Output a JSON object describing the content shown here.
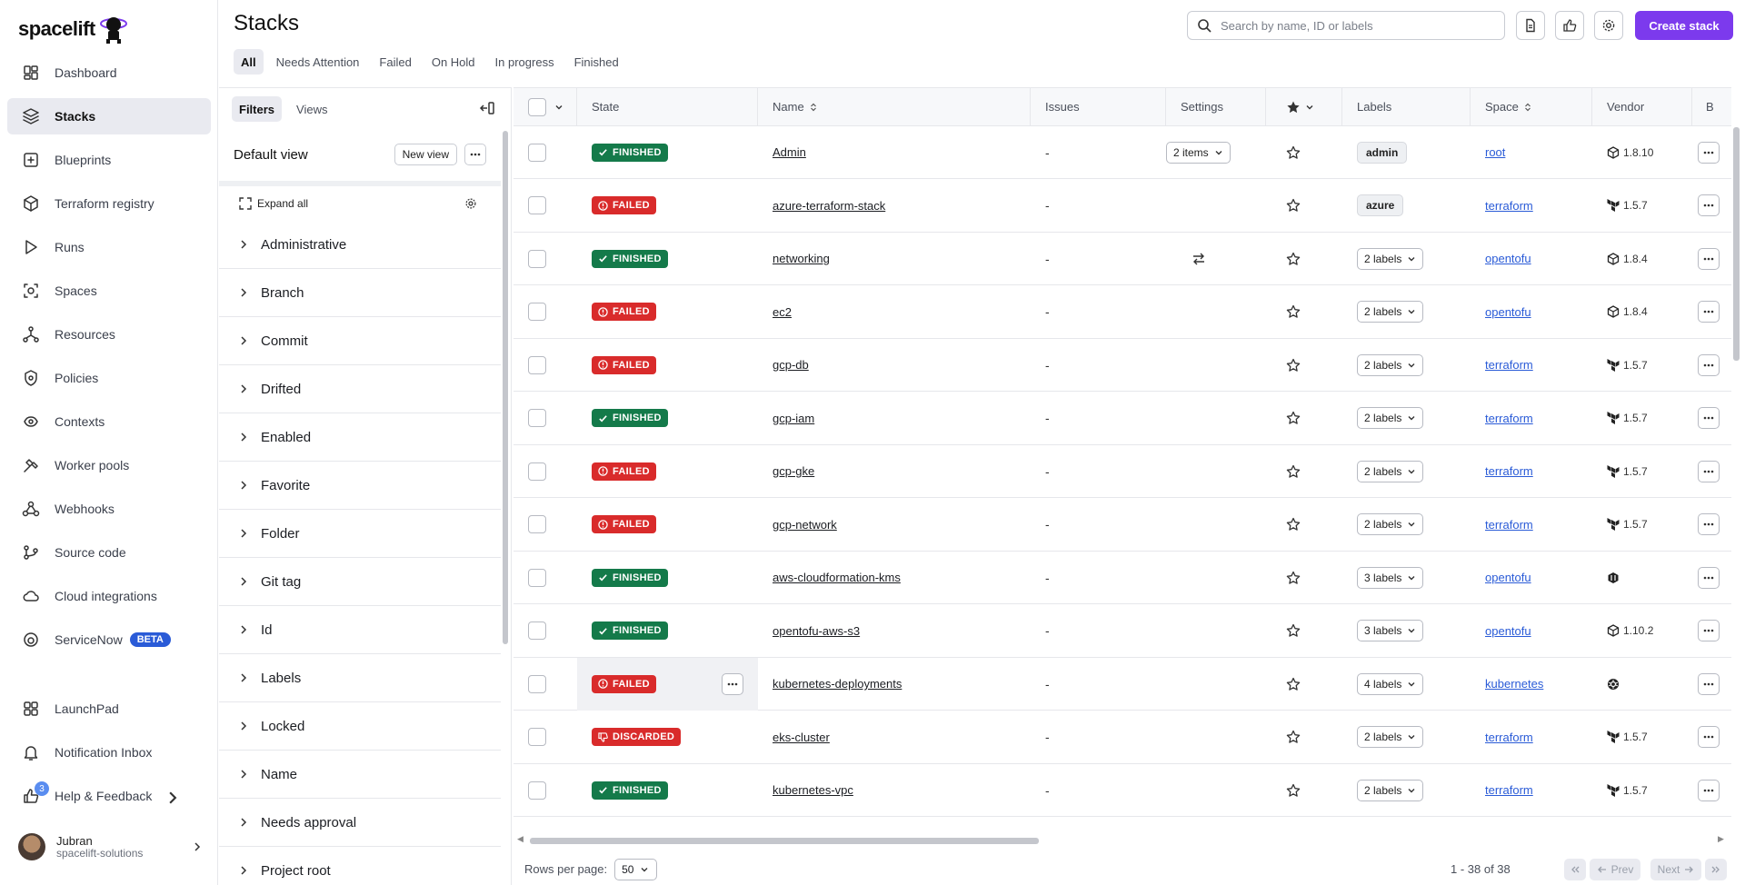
{
  "app": {
    "logo_text": "spacelift"
  },
  "sidebar": {
    "items": [
      {
        "label": "Dashboard",
        "icon": "dashboard-icon"
      },
      {
        "label": "Stacks",
        "icon": "stacks-icon",
        "active": true
      },
      {
        "label": "Blueprints",
        "icon": "blueprints-icon"
      },
      {
        "label": "Terraform registry",
        "icon": "cube-icon"
      },
      {
        "label": "Runs",
        "icon": "play-icon"
      },
      {
        "label": "Spaces",
        "icon": "spaces-icon"
      },
      {
        "label": "Resources",
        "icon": "resources-icon"
      },
      {
        "label": "Policies",
        "icon": "policies-icon"
      },
      {
        "label": "Contexts",
        "icon": "contexts-icon"
      },
      {
        "label": "Worker pools",
        "icon": "worker-pools-icon"
      },
      {
        "label": "Webhooks",
        "icon": "webhooks-icon"
      },
      {
        "label": "Source code",
        "icon": "source-code-icon"
      },
      {
        "label": "Cloud integrations",
        "icon": "cloud-icon"
      },
      {
        "label": "ServiceNow",
        "icon": "servicenow-icon",
        "badge": "BETA"
      }
    ],
    "bottom": [
      {
        "label": "LaunchPad",
        "icon": "launchpad-icon"
      },
      {
        "label": "Notification Inbox",
        "icon": "bell-icon"
      },
      {
        "label": "Help & Feedback",
        "icon": "thumbs-up-icon",
        "count": "3"
      }
    ],
    "user": {
      "name": "Jubran",
      "org": "spacelift-solutions"
    }
  },
  "header": {
    "title": "Stacks",
    "tabs": [
      "All",
      "Needs Attention",
      "Failed",
      "On Hold",
      "In progress",
      "Finished"
    ],
    "active_tab": "All",
    "search_placeholder": "Search by name, ID or labels",
    "create_label": "Create stack"
  },
  "filters": {
    "tabs": [
      "Filters",
      "Views"
    ],
    "view_title": "Default view",
    "new_view_label": "New view",
    "expand_all_label": "Expand all",
    "items": [
      "Administrative",
      "Branch",
      "Commit",
      "Drifted",
      "Enabled",
      "Favorite",
      "Folder",
      "Git tag",
      "Id",
      "Labels",
      "Locked",
      "Name",
      "Needs approval",
      "Project root"
    ]
  },
  "table": {
    "columns": {
      "state": "State",
      "name": "Name",
      "issues": "Issues",
      "settings": "Settings",
      "labels": "Labels",
      "space": "Space",
      "vendor": "Vendor",
      "extra": "B"
    },
    "rows": [
      {
        "state": "FINISHED",
        "kind": "finished",
        "name": "Admin",
        "issues": "-",
        "settings": "2 items",
        "settings_type": "dropdown",
        "label": "admin",
        "label_type": "chip",
        "space": "root",
        "vendor_icon": "opentofu-cube-icon",
        "vendor": "1.8.10"
      },
      {
        "state": "FAILED",
        "kind": "failed",
        "name": "azure-terraform-stack",
        "issues": "-",
        "settings": "",
        "settings_type": "none",
        "label": "azure",
        "label_type": "chip",
        "space": "terraform",
        "vendor_icon": "terraform-icon",
        "vendor": "1.5.7"
      },
      {
        "state": "FINISHED",
        "kind": "finished",
        "name": "networking",
        "issues": "-",
        "settings": "",
        "settings_type": "swap",
        "label": "2 labels",
        "label_type": "dropdown",
        "space": "opentofu",
        "vendor_icon": "opentofu-cube-icon",
        "vendor": "1.8.4"
      },
      {
        "state": "FAILED",
        "kind": "failed",
        "name": "ec2",
        "issues": "-",
        "settings": "",
        "settings_type": "none",
        "label": "2 labels",
        "label_type": "dropdown",
        "space": "opentofu",
        "vendor_icon": "opentofu-cube-icon",
        "vendor": "1.8.4"
      },
      {
        "state": "FAILED",
        "kind": "failed",
        "name": "gcp-db",
        "issues": "-",
        "settings": "",
        "settings_type": "none",
        "label": "2 labels",
        "label_type": "dropdown",
        "space": "terraform",
        "vendor_icon": "terraform-icon",
        "vendor": "1.5.7"
      },
      {
        "state": "FINISHED",
        "kind": "finished",
        "name": "gcp-iam",
        "issues": "-",
        "settings": "",
        "settings_type": "none",
        "label": "2 labels",
        "label_type": "dropdown",
        "space": "terraform",
        "vendor_icon": "terraform-icon",
        "vendor": "1.5.7"
      },
      {
        "state": "FAILED",
        "kind": "failed",
        "name": "gcp-gke",
        "issues": "-",
        "settings": "",
        "settings_type": "none",
        "label": "2 labels",
        "label_type": "dropdown",
        "space": "terraform",
        "vendor_icon": "terraform-icon",
        "vendor": "1.5.7"
      },
      {
        "state": "FAILED",
        "kind": "failed",
        "name": "gcp-network",
        "issues": "-",
        "settings": "",
        "settings_type": "none",
        "label": "2 labels",
        "label_type": "dropdown",
        "space": "terraform",
        "vendor_icon": "terraform-icon",
        "vendor": "1.5.7"
      },
      {
        "state": "FINISHED",
        "kind": "finished",
        "name": "aws-cloudformation-kms",
        "issues": "-",
        "settings": "",
        "settings_type": "none",
        "label": "3 labels",
        "label_type": "dropdown",
        "space": "opentofu",
        "vendor_icon": "cloudformation-icon",
        "vendor": ""
      },
      {
        "state": "FINISHED",
        "kind": "finished",
        "name": "opentofu-aws-s3",
        "issues": "-",
        "settings": "",
        "settings_type": "none",
        "label": "3 labels",
        "label_type": "dropdown",
        "space": "opentofu",
        "vendor_icon": "opentofu-cube-icon",
        "vendor": "1.10.2"
      },
      {
        "state": "FAILED",
        "kind": "failed",
        "name": "kubernetes-deployments",
        "issues": "-",
        "settings": "",
        "settings_type": "none",
        "label": "4 labels",
        "label_type": "dropdown",
        "space": "kubernetes",
        "vendor_icon": "kubernetes-icon",
        "vendor": "",
        "hover": true
      },
      {
        "state": "DISCARDED",
        "kind": "discarded",
        "name": "eks-cluster",
        "issues": "-",
        "settings": "",
        "settings_type": "none",
        "label": "2 labels",
        "label_type": "dropdown",
        "space": "terraform",
        "vendor_icon": "terraform-icon",
        "vendor": "1.5.7"
      },
      {
        "state": "FINISHED",
        "kind": "finished",
        "name": "kubernetes-vpc",
        "issues": "-",
        "settings": "",
        "settings_type": "none",
        "label": "2 labels",
        "label_type": "dropdown",
        "space": "terraform",
        "vendor_icon": "terraform-icon",
        "vendor": "1.5.7"
      }
    ]
  },
  "footer": {
    "rows_per_page_label": "Rows per page:",
    "rows_per_page": "50",
    "range": "1 - 38 of 38",
    "prev_label": "Prev",
    "next_label": "Next"
  },
  "colors": {
    "accent": "#7c3aed",
    "finished": "#147a4a",
    "failed": "#d92b2b",
    "link": "#2a5bd7"
  }
}
